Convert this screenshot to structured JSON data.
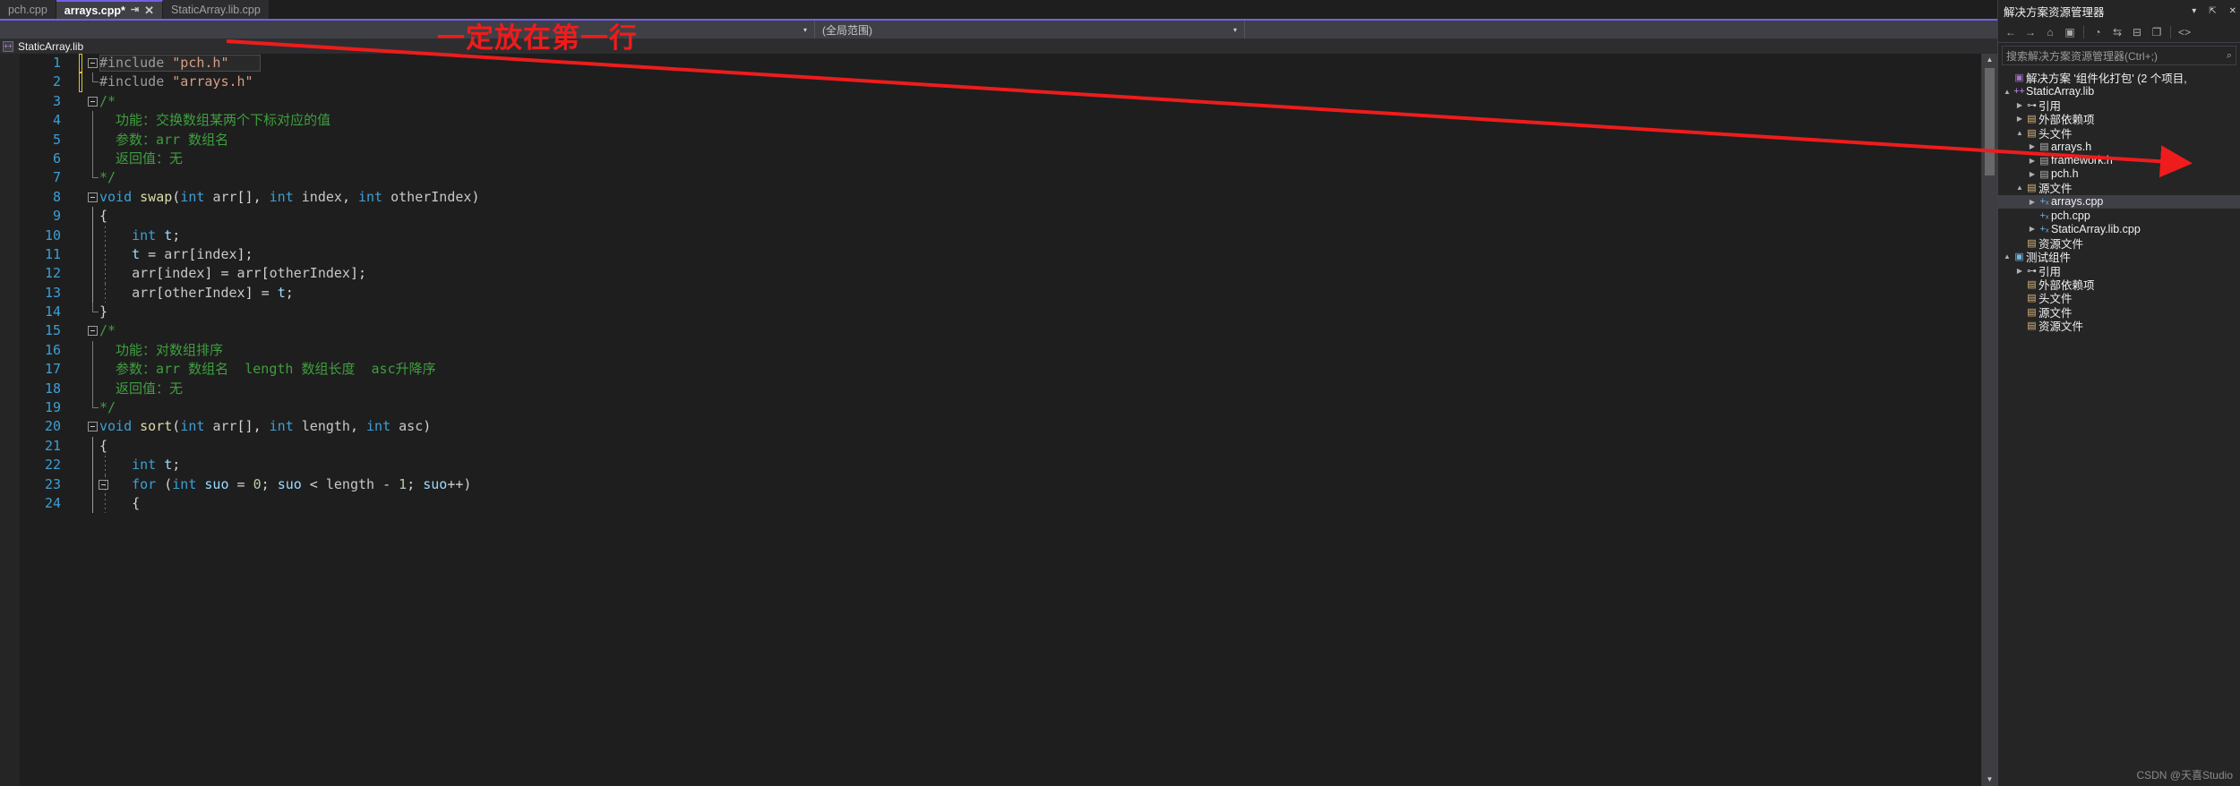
{
  "window": {
    "theme_bg": "#1e1e1e",
    "accent": "#7160e8",
    "annotation_color": "#ee1c1c"
  },
  "tabs": [
    {
      "label": "pch.cpp",
      "active": false,
      "modified": false
    },
    {
      "label": "arrays.cpp*",
      "active": true,
      "modified": true
    },
    {
      "label": "StaticArray.lib.cpp",
      "active": false,
      "modified": false
    }
  ],
  "tab_controls": {
    "pin_icon": "⇥",
    "close_icon": "✕",
    "dropdown_icon": "▾",
    "restore_icon": "⇱",
    "close_group_icon": "✕"
  },
  "navbar": {
    "scope_left": "",
    "scope_right": "(全局范围)",
    "caret_icon": "▾"
  },
  "project_bar": {
    "icon": "++",
    "name": "StaticArray.lib"
  },
  "editor": {
    "lines": [
      {
        "no": "1",
        "fold": "open",
        "guide": "none",
        "changed": true,
        "current": true,
        "tokens": [
          {
            "t": "pp",
            "v": "#include "
          },
          {
            "t": "str",
            "v": "\"pch.h\""
          }
        ]
      },
      {
        "no": "2",
        "fold": "none",
        "guide": "end",
        "changed": true,
        "current": false,
        "tokens": [
          {
            "t": "pp",
            "v": "#include "
          },
          {
            "t": "str",
            "v": "\"arrays.h\""
          }
        ]
      },
      {
        "no": "3",
        "fold": "open",
        "guide": "none",
        "changed": false,
        "current": false,
        "tokens": [
          {
            "t": "cmt",
            "v": "/*"
          }
        ]
      },
      {
        "no": "4",
        "fold": "none",
        "guide": "line",
        "changed": false,
        "current": false,
        "tokens": [
          {
            "t": "cmt",
            "v": "  功能：交换数组某两个下标对应的值"
          }
        ]
      },
      {
        "no": "5",
        "fold": "none",
        "guide": "line",
        "changed": false,
        "current": false,
        "tokens": [
          {
            "t": "cmt",
            "v": "  参数：arr 数组名"
          }
        ]
      },
      {
        "no": "6",
        "fold": "none",
        "guide": "line",
        "changed": false,
        "current": false,
        "tokens": [
          {
            "t": "cmt",
            "v": "  返回值：无"
          }
        ]
      },
      {
        "no": "7",
        "fold": "none",
        "guide": "end",
        "changed": false,
        "current": false,
        "tokens": [
          {
            "t": "cmt",
            "v": "*/"
          }
        ]
      },
      {
        "no": "8",
        "fold": "open",
        "guide": "none",
        "changed": false,
        "current": false,
        "tokens": [
          {
            "t": "kw",
            "v": "void"
          },
          {
            "t": "pun",
            "v": " "
          },
          {
            "t": "fn",
            "v": "swap"
          },
          {
            "t": "pun",
            "v": "("
          },
          {
            "t": "kw",
            "v": "int"
          },
          {
            "t": "pun",
            "v": " "
          },
          {
            "t": "id",
            "v": "arr"
          },
          {
            "t": "pun",
            "v": "[], "
          },
          {
            "t": "kw",
            "v": "int"
          },
          {
            "t": "pun",
            "v": " "
          },
          {
            "t": "id",
            "v": "index"
          },
          {
            "t": "pun",
            "v": ", "
          },
          {
            "t": "kw",
            "v": "int"
          },
          {
            "t": "pun",
            "v": " "
          },
          {
            "t": "id",
            "v": "otherIndex"
          },
          {
            "t": "pun",
            "v": ")"
          }
        ]
      },
      {
        "no": "9",
        "fold": "none",
        "guide": "solid",
        "changed": false,
        "current": false,
        "tokens": [
          {
            "t": "pun",
            "v": "{"
          }
        ]
      },
      {
        "no": "10",
        "fold": "none",
        "guide": "solid-dot",
        "changed": false,
        "current": false,
        "tokens": [
          {
            "t": "pun",
            "v": "    "
          },
          {
            "t": "kw",
            "v": "int"
          },
          {
            "t": "pun",
            "v": " "
          },
          {
            "t": "var",
            "v": "t"
          },
          {
            "t": "pun",
            "v": ";"
          }
        ]
      },
      {
        "no": "11",
        "fold": "none",
        "guide": "solid-dot",
        "changed": false,
        "current": false,
        "tokens": [
          {
            "t": "pun",
            "v": "    "
          },
          {
            "t": "var",
            "v": "t"
          },
          {
            "t": "pun",
            "v": " = "
          },
          {
            "t": "id",
            "v": "arr"
          },
          {
            "t": "pun",
            "v": "["
          },
          {
            "t": "id",
            "v": "index"
          },
          {
            "t": "pun",
            "v": "];"
          }
        ]
      },
      {
        "no": "12",
        "fold": "none",
        "guide": "solid-dot",
        "changed": false,
        "current": false,
        "tokens": [
          {
            "t": "pun",
            "v": "    "
          },
          {
            "t": "id",
            "v": "arr"
          },
          {
            "t": "pun",
            "v": "["
          },
          {
            "t": "id",
            "v": "index"
          },
          {
            "t": "pun",
            "v": "] = "
          },
          {
            "t": "id",
            "v": "arr"
          },
          {
            "t": "pun",
            "v": "["
          },
          {
            "t": "id",
            "v": "otherIndex"
          },
          {
            "t": "pun",
            "v": "];"
          }
        ]
      },
      {
        "no": "13",
        "fold": "none",
        "guide": "solid-dot",
        "changed": false,
        "current": false,
        "tokens": [
          {
            "t": "pun",
            "v": "    "
          },
          {
            "t": "id",
            "v": "arr"
          },
          {
            "t": "pun",
            "v": "["
          },
          {
            "t": "id",
            "v": "otherIndex"
          },
          {
            "t": "pun",
            "v": "] = "
          },
          {
            "t": "var",
            "v": "t"
          },
          {
            "t": "pun",
            "v": ";"
          }
        ]
      },
      {
        "no": "14",
        "fold": "none",
        "guide": "solid-end",
        "changed": false,
        "current": false,
        "tokens": [
          {
            "t": "pun",
            "v": "}"
          }
        ]
      },
      {
        "no": "15",
        "fold": "open",
        "guide": "none",
        "changed": false,
        "current": false,
        "tokens": [
          {
            "t": "cmt",
            "v": "/*"
          }
        ]
      },
      {
        "no": "16",
        "fold": "none",
        "guide": "line",
        "changed": false,
        "current": false,
        "tokens": [
          {
            "t": "cmt",
            "v": "  功能：对数组排序"
          }
        ]
      },
      {
        "no": "17",
        "fold": "none",
        "guide": "line",
        "changed": false,
        "current": false,
        "tokens": [
          {
            "t": "cmt",
            "v": "  参数：arr 数组名  length 数组长度  asc升降序"
          }
        ]
      },
      {
        "no": "18",
        "fold": "none",
        "guide": "line",
        "changed": false,
        "current": false,
        "tokens": [
          {
            "t": "cmt",
            "v": "  返回值：无"
          }
        ]
      },
      {
        "no": "19",
        "fold": "none",
        "guide": "end",
        "changed": false,
        "current": false,
        "tokens": [
          {
            "t": "cmt",
            "v": "*/"
          }
        ]
      },
      {
        "no": "20",
        "fold": "open",
        "guide": "none",
        "changed": false,
        "current": false,
        "tokens": [
          {
            "t": "kw",
            "v": "void"
          },
          {
            "t": "pun",
            "v": " "
          },
          {
            "t": "fn",
            "v": "sort"
          },
          {
            "t": "pun",
            "v": "("
          },
          {
            "t": "kw",
            "v": "int"
          },
          {
            "t": "pun",
            "v": " "
          },
          {
            "t": "id",
            "v": "arr"
          },
          {
            "t": "pun",
            "v": "[], "
          },
          {
            "t": "kw",
            "v": "int"
          },
          {
            "t": "pun",
            "v": " "
          },
          {
            "t": "id",
            "v": "length"
          },
          {
            "t": "pun",
            "v": ", "
          },
          {
            "t": "kw",
            "v": "int"
          },
          {
            "t": "pun",
            "v": " "
          },
          {
            "t": "id",
            "v": "asc"
          },
          {
            "t": "pun",
            "v": ")"
          }
        ]
      },
      {
        "no": "21",
        "fold": "none",
        "guide": "solid",
        "changed": false,
        "current": false,
        "tokens": [
          {
            "t": "pun",
            "v": "{"
          }
        ]
      },
      {
        "no": "22",
        "fold": "none",
        "guide": "solid-dot",
        "changed": false,
        "current": false,
        "tokens": [
          {
            "t": "pun",
            "v": "    "
          },
          {
            "t": "kw",
            "v": "int"
          },
          {
            "t": "pun",
            "v": " "
          },
          {
            "t": "var",
            "v": "t"
          },
          {
            "t": "pun",
            "v": ";"
          }
        ]
      },
      {
        "no": "23",
        "fold": "open2",
        "guide": "solid-dot",
        "changed": false,
        "current": false,
        "tokens": [
          {
            "t": "pun",
            "v": "    "
          },
          {
            "t": "kw",
            "v": "for"
          },
          {
            "t": "pun",
            "v": " ("
          },
          {
            "t": "kw",
            "v": "int"
          },
          {
            "t": "pun",
            "v": " "
          },
          {
            "t": "var",
            "v": "suo"
          },
          {
            "t": "pun",
            "v": " = "
          },
          {
            "t": "num",
            "v": "0"
          },
          {
            "t": "pun",
            "v": "; "
          },
          {
            "t": "var",
            "v": "suo"
          },
          {
            "t": "pun",
            "v": " < "
          },
          {
            "t": "id",
            "v": "length"
          },
          {
            "t": "pun",
            "v": " - "
          },
          {
            "t": "num",
            "v": "1"
          },
          {
            "t": "pun",
            "v": "; "
          },
          {
            "t": "var",
            "v": "suo"
          },
          {
            "t": "pun",
            "v": "++)"
          }
        ]
      },
      {
        "no": "24",
        "fold": "none",
        "guide": "solid-dot",
        "changed": false,
        "current": false,
        "tokens": [
          {
            "t": "pun",
            "v": "    {"
          }
        ]
      }
    ],
    "scroll_up_icon": "▲",
    "scroll_down_icon": "▼"
  },
  "solution_explorer": {
    "title": "解决方案资源管理器",
    "title_dropdown_icon": "▾",
    "title_pin_icon": "⇱",
    "title_close_icon": "✕",
    "toolbar_icons": [
      "back-arrow",
      "forward-arrow",
      "home",
      "show-all-files",
      "pending-changes",
      "sync-with-active",
      "collapse-all",
      "properties",
      "code-view"
    ],
    "toolbar_glyphs": [
      "←",
      "→",
      "⌂",
      "▣",
      "◔",
      "⇆",
      "⊟",
      "❐",
      "<>"
    ],
    "search_placeholder": "搜索解决方案资源管理器(Ctrl+;)",
    "search_icon": "🔍",
    "tree": [
      {
        "indent": 1,
        "twisty": "",
        "icon": "sln",
        "icon_glyph": "▣",
        "label": "解决方案 '组件化打包' (2 个项目,",
        "selected": false
      },
      {
        "indent": 1,
        "twisty": "▲",
        "icon": "cpp",
        "icon_glyph": "++",
        "label": "StaticArray.lib",
        "selected": false
      },
      {
        "indent": 2,
        "twisty": "▶",
        "icon": "ref",
        "icon_glyph": "⊶",
        "label": "引用",
        "selected": false
      },
      {
        "indent": 2,
        "twisty": "▶",
        "icon": "fold",
        "icon_glyph": "▤",
        "label": "外部依赖项",
        "selected": false
      },
      {
        "indent": 2,
        "twisty": "▲",
        "icon": "fold",
        "icon_glyph": "▤",
        "label": "头文件",
        "selected": false
      },
      {
        "indent": 3,
        "twisty": "▶",
        "icon": "h",
        "icon_glyph": "▤",
        "label": "arrays.h",
        "selected": false
      },
      {
        "indent": 3,
        "twisty": "▶",
        "icon": "h",
        "icon_glyph": "▤",
        "label": "framework.h",
        "selected": false
      },
      {
        "indent": 3,
        "twisty": "▶",
        "icon": "h",
        "icon_glyph": "▤",
        "label": "pch.h",
        "selected": false
      },
      {
        "indent": 2,
        "twisty": "▲",
        "icon": "fold",
        "icon_glyph": "▤",
        "label": "源文件",
        "selected": false
      },
      {
        "indent": 3,
        "twisty": "▶",
        "icon": "src",
        "icon_glyph": "+ₓ",
        "label": "arrays.cpp",
        "selected": true
      },
      {
        "indent": 3,
        "twisty": "",
        "icon": "src",
        "icon_glyph": "+ₓ",
        "label": "pch.cpp",
        "selected": false
      },
      {
        "indent": 3,
        "twisty": "▶",
        "icon": "src",
        "icon_glyph": "+ₓ",
        "label": "StaticArray.lib.cpp",
        "selected": false
      },
      {
        "indent": 2,
        "twisty": "",
        "icon": "fold",
        "icon_glyph": "▤",
        "label": "资源文件",
        "selected": false
      },
      {
        "indent": 1,
        "twisty": "▲",
        "icon": "test",
        "icon_glyph": "▣",
        "label": "测试组件",
        "selected": false
      },
      {
        "indent": 2,
        "twisty": "▶",
        "icon": "ref",
        "icon_glyph": "⊶",
        "label": "引用",
        "selected": false
      },
      {
        "indent": 2,
        "twisty": "",
        "icon": "fold",
        "icon_glyph": "▤",
        "label": "外部依赖项",
        "selected": false
      },
      {
        "indent": 2,
        "twisty": "",
        "icon": "fold",
        "icon_glyph": "▤",
        "label": "头文件",
        "selected": false
      },
      {
        "indent": 2,
        "twisty": "",
        "icon": "fold",
        "icon_glyph": "▤",
        "label": "源文件",
        "selected": false
      },
      {
        "indent": 2,
        "twisty": "",
        "icon": "fold",
        "icon_glyph": "▤",
        "label": "资源文件",
        "selected": false
      }
    ]
  },
  "annotation": {
    "text": "一定放在第一行",
    "arrow_description": "red arrow from code line 1 to pch.h in solution explorer"
  },
  "watermark": "CSDN @天喜Studio"
}
